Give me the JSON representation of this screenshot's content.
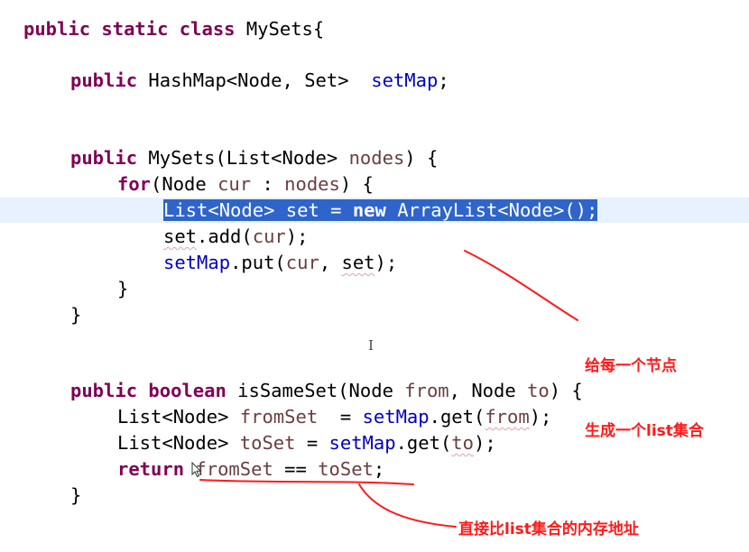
{
  "code": {
    "line1": {
      "kw": "public static class ",
      "text": "MySets{"
    },
    "line2": {
      "kw": "public ",
      "text": "HashMap<Node, Set>  ",
      "field": "setMap",
      "end": ";"
    },
    "line3": {
      "kw": "public ",
      "a": "MySets(List<Node> ",
      "param": "nodes",
      "b": ") {"
    },
    "line4": {
      "kw": "for",
      "a": "(Node ",
      "v1": "cur",
      "b": " : ",
      "v2": "nodes",
      "c": ") {"
    },
    "line5": {
      "a": "List<Node> set = ",
      "kw": "new",
      "b": " ArrayList<Node>();"
    },
    "line6": {
      "a": "set",
      "b": ".add(",
      "v": "cur",
      "c": ");"
    },
    "line7": {
      "field": "setMap",
      "a": ".put(",
      "v": "cur",
      "b": ", ",
      "v2": "set",
      "c": ");"
    },
    "line8": {
      "text": "}"
    },
    "line9": {
      "text": "}"
    },
    "line10": {
      "kw": "public boolean ",
      "a": "isSameSet(Node ",
      "p1": "from",
      "b": ", Node ",
      "p2": "to",
      "c": ") {"
    },
    "line11": {
      "a": "List<Node> ",
      "v": "fromSet",
      "b": "  = ",
      "field": "setMap",
      "c": ".get(",
      "p": "from",
      "d": ");"
    },
    "line12": {
      "a": "List<Node> ",
      "v": "toSet",
      "b": " = ",
      "field": "setMap",
      "c": ".get(",
      "p": "to",
      "d": ");"
    },
    "line13": {
      "kw": "return ",
      "v1": "fromSet",
      "a": " == ",
      "v2": "toSet",
      "b": ";"
    },
    "line14": {
      "text": "}"
    }
  },
  "annotations": {
    "note1_line1": "给每一个节点",
    "note1_line2": "生成一个list集合",
    "note2": "直接比list集合的内存地址"
  },
  "colors": {
    "keyword": "#7f0055",
    "field": "#0000c0",
    "variable": "#6a3e3e",
    "selection": "#2f65ca",
    "annotation": "#ff1a1a"
  },
  "icons": {
    "text_cursor": "I-beam",
    "mouse_pointer": "arrow"
  }
}
